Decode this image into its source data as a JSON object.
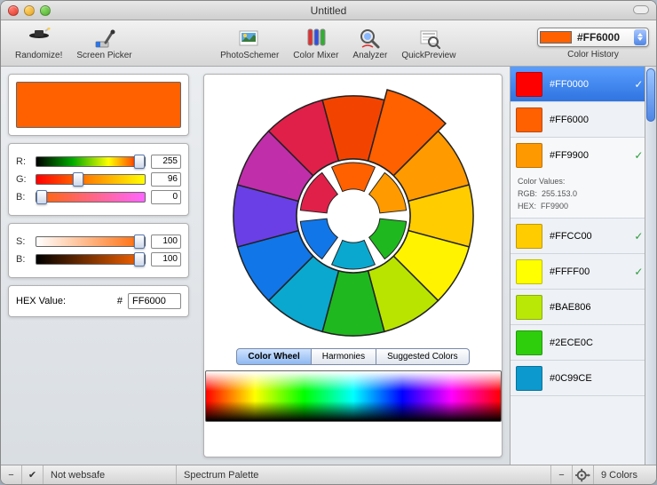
{
  "window": {
    "title": "Untitled"
  },
  "toolbar": {
    "randomize": "Randomize!",
    "screen_picker": "Screen Picker",
    "photoschemer": "PhotoSchemer",
    "color_mixer": "Color Mixer",
    "analyzer": "Analyzer",
    "quickpreview": "QuickPreview",
    "hex_dropdown": "#FF6000",
    "hex_swatch": "#FF6000",
    "history_label": "Color History"
  },
  "left": {
    "swatch": "#FF6000",
    "r_label": "R:",
    "r_value": "255",
    "g_label": "G:",
    "g_value": "96",
    "b_label": "B:",
    "b_value": "0",
    "s_label": "S:",
    "s_value": "100",
    "br_label": "B:",
    "br_value": "100",
    "hex_label": "HEX Value:",
    "hex_prefix": "#",
    "hex_value": "FF6000"
  },
  "mid": {
    "tab_wheel": "Color Wheel",
    "tab_harmonies": "Harmonies",
    "tab_suggested": "Suggested Colors",
    "wheel_colors": [
      "#F24400",
      "#FF6000",
      "#FF9A00",
      "#FFCC00",
      "#FFF300",
      "#B9E400",
      "#1FB81F",
      "#0AA8CF",
      "#1176E8",
      "#6A3FE6",
      "#C02EAA",
      "#E02048"
    ],
    "inner_colors": [
      "#FF6000",
      "#FF9A00",
      "#1FB81F",
      "#0AA8CF",
      "#1176E8",
      "#E02048"
    ]
  },
  "history": [
    {
      "hex": "#FF0000",
      "color": "#FF0000",
      "selected": true,
      "check": true,
      "arrow": "▸"
    },
    {
      "hex": "#FF6000",
      "color": "#FF6000",
      "selected": false,
      "check": false,
      "arrow": "▸"
    },
    {
      "hex": "#FF9900",
      "color": "#FF9900",
      "selected": false,
      "check": true,
      "arrow": "▾",
      "expanded": true,
      "details_label": "Color Values:",
      "details_rgb_label": "RGB:",
      "details_rgb": "255.153.0",
      "details_hex_label": "HEX:",
      "details_hex": "FF9900"
    },
    {
      "hex": "#FFCC00",
      "color": "#FFCC00",
      "selected": false,
      "check": true,
      "arrow": "▸"
    },
    {
      "hex": "#FFFF00",
      "color": "#FFFF00",
      "selected": false,
      "check": true,
      "arrow": "▸"
    },
    {
      "hex": "#BAE806",
      "color": "#BAE806",
      "selected": false,
      "check": false,
      "arrow": "▸"
    },
    {
      "hex": "#2ECE0C",
      "color": "#2ECE0C",
      "selected": false,
      "check": false,
      "arrow": "▸"
    },
    {
      "hex": "#0C99CE",
      "color": "#0C99CE",
      "selected": false,
      "check": false,
      "arrow": "▸"
    }
  ],
  "status": {
    "websafe": "Not websafe",
    "palette": "Spectrum Palette",
    "count": "9 Colors"
  }
}
